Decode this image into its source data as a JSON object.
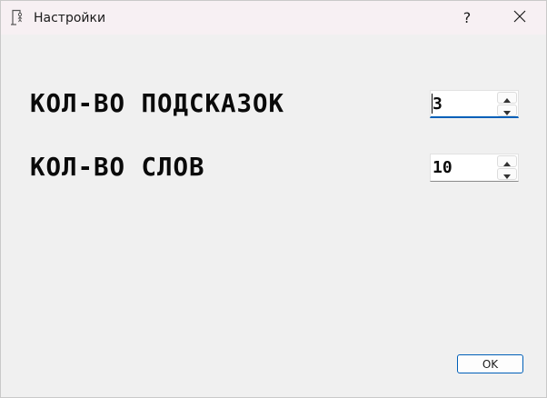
{
  "window": {
    "title": "Настройки",
    "help_label": "?",
    "icons": {
      "app": "hangman-icon",
      "close": "close-icon"
    }
  },
  "settings": {
    "hints": {
      "label": "КОЛ-ВО ПОДСКАЗОК",
      "value": "3"
    },
    "words": {
      "label": "КОЛ-ВО СЛОВ",
      "value": "10"
    }
  },
  "footer": {
    "ok_label": "OK"
  },
  "colors": {
    "accent": "#005fb8",
    "titlebar": "#f7f0f3",
    "background": "#f0f0f0"
  }
}
